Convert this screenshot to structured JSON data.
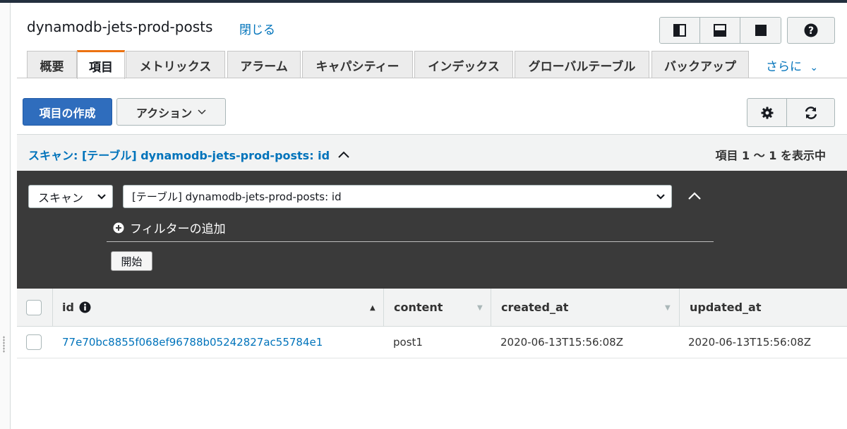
{
  "header": {
    "title": "dynamodb-jets-prod-posts",
    "close_label": "閉じる"
  },
  "view_toggles": [
    {
      "icon": "split-right-icon"
    },
    {
      "icon": "split-bottom-icon"
    },
    {
      "icon": "full-panel-icon"
    }
  ],
  "help_icon": "question-circle-icon",
  "tabs": [
    {
      "label": "概要"
    },
    {
      "label": "項目",
      "active": true
    },
    {
      "label": "メトリックス"
    },
    {
      "label": "アラーム"
    },
    {
      "label": "キャパシティー"
    },
    {
      "label": "インデックス"
    },
    {
      "label": "グローバルテーブル"
    },
    {
      "label": "バックアップ"
    }
  ],
  "tab_more_label": "さらに",
  "toolbar": {
    "create_label": "項目の作成",
    "actions_label": "アクション",
    "settings_icon": "gear-icon",
    "refresh_icon": "refresh-icon"
  },
  "scan": {
    "summary": "スキャン: [テーブル] dynamodb-jets-prod-posts: id",
    "count_text": "項目 1 〜 1 を表示中",
    "mode_value": "スキャン",
    "target_value": "[テーブル] dynamodb-jets-prod-posts: id",
    "add_filter_label": "フィルターの追加",
    "start_label": "開始"
  },
  "table": {
    "columns": [
      {
        "label": "id"
      },
      {
        "label": "content"
      },
      {
        "label": "created_at"
      },
      {
        "label": "updated_at"
      }
    ],
    "rows": [
      {
        "id": "77e70bc8855f068ef96788b05242827ac55784e1",
        "content": "post1",
        "created_at": "2020-06-13T15:56:08Z",
        "updated_at": "2020-06-13T15:56:08Z"
      }
    ]
  },
  "colors": {
    "primary": "#2f6dbd",
    "link": "#0073bb",
    "active_tab_accent": "#ec7211",
    "panel_bg": "#3a3a3a"
  }
}
